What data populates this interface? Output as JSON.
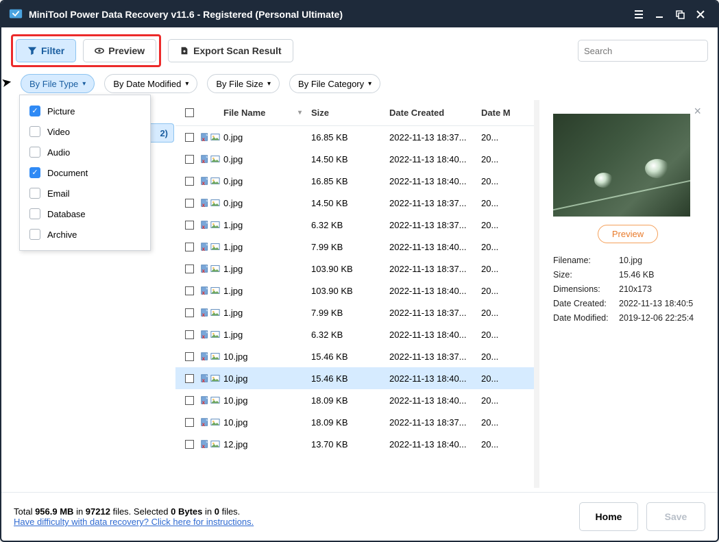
{
  "window": {
    "title": "MiniTool Power Data Recovery v11.6 - Registered (Personal Ultimate)"
  },
  "toolbar": {
    "filter": "Filter",
    "preview": "Preview",
    "export": "Export Scan Result"
  },
  "search": {
    "placeholder": "Search"
  },
  "filters": {
    "by_type": "By File Type",
    "by_date": "By Date Modified",
    "by_size": "By File Size",
    "by_cat": "By File Category"
  },
  "type_menu": [
    {
      "label": "Picture",
      "checked": true
    },
    {
      "label": "Video",
      "checked": false
    },
    {
      "label": "Audio",
      "checked": false
    },
    {
      "label": "Document",
      "checked": true
    },
    {
      "label": "Email",
      "checked": false
    },
    {
      "label": "Database",
      "checked": false
    },
    {
      "label": "Archive",
      "checked": false
    }
  ],
  "tab_behind": "2)",
  "columns": {
    "name": "File Name",
    "size": "Size",
    "created": "Date Created",
    "modified": "Date M"
  },
  "rows": [
    {
      "name": "0.jpg",
      "size": "16.85 KB",
      "created": "2022-11-13 18:37...",
      "mod": "20...",
      "sel": false
    },
    {
      "name": "0.jpg",
      "size": "14.50 KB",
      "created": "2022-11-13 18:40...",
      "mod": "20...",
      "sel": false
    },
    {
      "name": "0.jpg",
      "size": "16.85 KB",
      "created": "2022-11-13 18:40...",
      "mod": "20...",
      "sel": false
    },
    {
      "name": "0.jpg",
      "size": "14.50 KB",
      "created": "2022-11-13 18:37...",
      "mod": "20...",
      "sel": false
    },
    {
      "name": "1.jpg",
      "size": "6.32 KB",
      "created": "2022-11-13 18:37...",
      "mod": "20...",
      "sel": false
    },
    {
      "name": "1.jpg",
      "size": "7.99 KB",
      "created": "2022-11-13 18:40...",
      "mod": "20...",
      "sel": false
    },
    {
      "name": "1.jpg",
      "size": "103.90 KB",
      "created": "2022-11-13 18:37...",
      "mod": "20...",
      "sel": false
    },
    {
      "name": "1.jpg",
      "size": "103.90 KB",
      "created": "2022-11-13 18:40...",
      "mod": "20...",
      "sel": false
    },
    {
      "name": "1.jpg",
      "size": "7.99 KB",
      "created": "2022-11-13 18:37...",
      "mod": "20...",
      "sel": false
    },
    {
      "name": "1.jpg",
      "size": "6.32 KB",
      "created": "2022-11-13 18:40...",
      "mod": "20...",
      "sel": false
    },
    {
      "name": "10.jpg",
      "size": "15.46 KB",
      "created": "2022-11-13 18:37...",
      "mod": "20...",
      "sel": false
    },
    {
      "name": "10.jpg",
      "size": "15.46 KB",
      "created": "2022-11-13 18:40...",
      "mod": "20...",
      "sel": true
    },
    {
      "name": "10.jpg",
      "size": "18.09 KB",
      "created": "2022-11-13 18:40...",
      "mod": "20...",
      "sel": false
    },
    {
      "name": "10.jpg",
      "size": "18.09 KB",
      "created": "2022-11-13 18:37...",
      "mod": "20...",
      "sel": false
    },
    {
      "name": "12.jpg",
      "size": "13.70 KB",
      "created": "2022-11-13 18:40...",
      "mod": "20...",
      "sel": false
    }
  ],
  "preview": {
    "button": "Preview",
    "labels": {
      "filename": "Filename:",
      "size": "Size:",
      "dimensions": "Dimensions:",
      "created": "Date Created:",
      "modified": "Date Modified:"
    },
    "values": {
      "filename": "10.jpg",
      "size": "15.46 KB",
      "dimensions": "210x173",
      "created": "2022-11-13 18:40:5",
      "modified": "2019-12-06 22:25:4"
    }
  },
  "footer": {
    "total_label": "Total ",
    "total_size": "956.9 MB",
    "in1": " in ",
    "total_files": "97212",
    "files_label": " files. ",
    "sel_label": "Selected ",
    "sel_bytes": "0 Bytes",
    "in2": " in ",
    "sel_files": "0",
    "files2": " files.",
    "help": "Have difficulty with data recovery? Click here for instructions.",
    "home": "Home",
    "save": "Save"
  }
}
